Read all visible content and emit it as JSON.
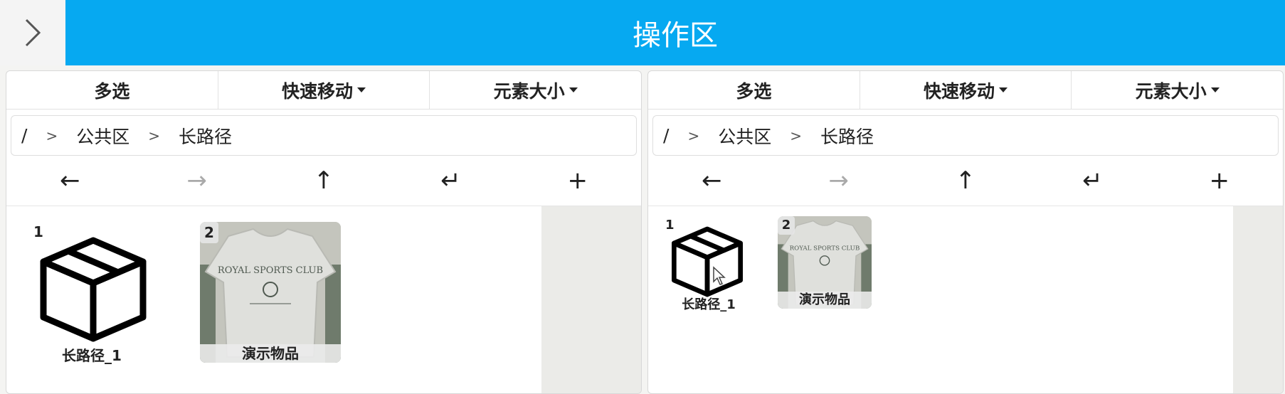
{
  "header": {
    "title": "操作区"
  },
  "panels": [
    {
      "toolbar": {
        "multi": "多选",
        "quick_move": "快速移动",
        "size": "元素大小"
      },
      "breadcrumb": {
        "root": "/",
        "sep": ">",
        "items": [
          "公共区",
          "长路径"
        ]
      },
      "nav": {
        "back": "←",
        "forward": "→",
        "up": "↑",
        "enter": "↵",
        "add": "+"
      },
      "items": [
        {
          "index": "1",
          "label": "长路径_1",
          "icon": "box-icon"
        },
        {
          "index": "2",
          "label": "演示物品",
          "icon": "tshirt-image"
        }
      ]
    },
    {
      "toolbar": {
        "multi": "多选",
        "quick_move": "快速移动",
        "size": "元素大小"
      },
      "breadcrumb": {
        "root": "/",
        "sep": ">",
        "items": [
          "公共区",
          "长路径"
        ]
      },
      "nav": {
        "back": "←",
        "forward": "→",
        "up": "↑",
        "enter": "↵",
        "add": "+"
      },
      "items": [
        {
          "index": "1",
          "label": "长路径_1",
          "icon": "box-icon"
        },
        {
          "index": "2",
          "label": "演示物品",
          "icon": "tshirt-image"
        }
      ]
    }
  ]
}
